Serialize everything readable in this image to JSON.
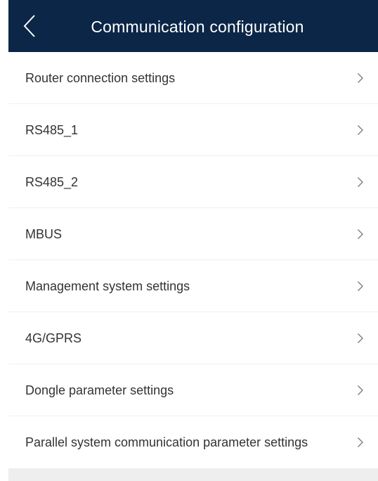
{
  "header": {
    "title": "Communication configuration",
    "back_icon": "chevron-left-icon",
    "background_color": "#0c2647"
  },
  "menu": {
    "items": [
      {
        "label": "Router connection settings",
        "icon": "chevron-right-icon"
      },
      {
        "label": "RS485_1",
        "icon": "chevron-right-icon"
      },
      {
        "label": "RS485_2",
        "icon": "chevron-right-icon"
      },
      {
        "label": "MBUS",
        "icon": "chevron-right-icon"
      },
      {
        "label": "Management system settings",
        "icon": "chevron-right-icon"
      },
      {
        "label": "4G/GPRS",
        "icon": "chevron-right-icon"
      },
      {
        "label": "Dongle parameter settings",
        "icon": "chevron-right-icon"
      },
      {
        "label": "Parallel system communication parameter settings",
        "icon": "chevron-right-icon"
      }
    ]
  }
}
